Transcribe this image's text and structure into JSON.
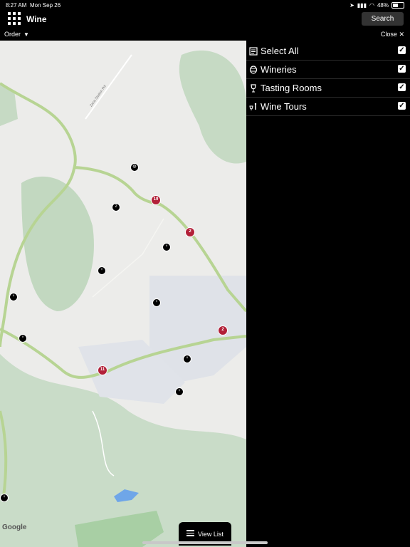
{
  "status": {
    "time": "8:27 AM",
    "date": "Mon Sep 26",
    "battery": "48%",
    "battery_level": 0.48
  },
  "header": {
    "title": "Wine",
    "search_label": "Search"
  },
  "subbar": {
    "order_label": "Order",
    "close_label": "Close"
  },
  "map": {
    "attribution": "Google",
    "road_label": "Zaca Station Rd",
    "clusters": [
      {
        "count": "19"
      },
      {
        "count": "2"
      },
      {
        "count": "2"
      },
      {
        "count": "11"
      }
    ],
    "pin_count": "2",
    "view_list_label": "View List"
  },
  "filter_panel": {
    "items": [
      {
        "label": "Select All",
        "icon": "list-icon",
        "checked": true
      },
      {
        "label": "Wineries",
        "icon": "barrel-icon",
        "checked": true
      },
      {
        "label": "Tasting Rooms",
        "icon": "wine-glass-icon",
        "checked": true
      },
      {
        "label": "Wine Tours",
        "icon": "wine-tour-icon",
        "checked": true
      }
    ]
  }
}
